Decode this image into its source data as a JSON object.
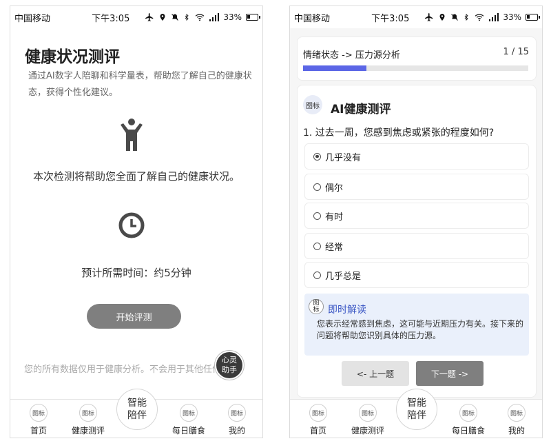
{
  "status_bar": {
    "carrier": "中国移动",
    "time": "下午3:05",
    "battery": "33%",
    "icons": [
      "airplane-icon",
      "location-icon",
      "mute-icon",
      "bluetooth-icon",
      "wifi-icon",
      "signal-icon",
      "battery-icon"
    ]
  },
  "left": {
    "title": "健康状况测评",
    "description": "通过AI数字人陪聊和科学量表，帮助您了解自己的健康状态，获得个性化建议。",
    "info_text": "本次检测将帮助您全面了解自己的健康状况。",
    "time_text": "预计所需时间：约5分钟",
    "start_button": "开始评测",
    "privacy": "您的所有数据仅用于健康分析。不会用于其他任何用途。",
    "fab": "心灵助手"
  },
  "right": {
    "breadcrumb": "情绪状态 -> 压力源分析",
    "progress_text": "1 / 15",
    "progress": {
      "current": 1,
      "total": 15,
      "fill_fraction": 0.28
    },
    "card_badge": "图标",
    "card_title": "AI健康测评",
    "question": "1. 过去一周，您感到焦虑或紧张的程度如何?",
    "options": [
      {
        "label": "几乎没有",
        "selected": true
      },
      {
        "label": "偶尔",
        "selected": false
      },
      {
        "label": "有时",
        "selected": false
      },
      {
        "label": "经常",
        "selected": false
      },
      {
        "label": "几乎总是",
        "selected": false
      }
    ],
    "insight": {
      "icon_label": "图标",
      "title": "即时解读",
      "text": "您表示经常感到焦虑，这可能与近期压力有关。接下来的问题将帮助您识别具体的压力源。"
    },
    "prev_button": "<- 上一题",
    "next_button": "下一题 ->"
  },
  "bottom_nav": {
    "icon_label": "图标",
    "center": "智能陪伴",
    "items": [
      "首页",
      "健康测评",
      "每日膳食",
      "我的"
    ]
  },
  "colors": {
    "accent": "#5b66e6",
    "button_gray": "#7f7f7f",
    "insight_bg": "#eaf0fb",
    "insight_title": "#3a56c4"
  }
}
